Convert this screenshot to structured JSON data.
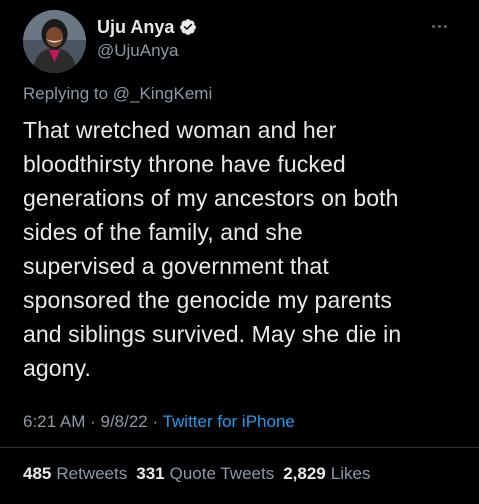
{
  "author": {
    "name": "Uju Anya",
    "handle": "@UjuAnya"
  },
  "reply_to": "Replying to @_KingKemi",
  "tweet_lines": [
    "That wretched woman and her",
    "bloodthirsty throne have fucked",
    "generations of my ancestors on both",
    "sides of the family, and she",
    "supervised a government that",
    "sponsored the genocide my parents",
    "and siblings survived. May she die in",
    "agony."
  ],
  "meta": {
    "time": "6:21 AM",
    "date": "9/8/22",
    "separator": "·",
    "source": "Twitter for iPhone"
  },
  "stats": {
    "retweets": {
      "count": "485",
      "label": "Retweets"
    },
    "quote_tweets": {
      "count": "331",
      "label": "Quote Tweets"
    },
    "likes": {
      "count": "2,829",
      "label": "Likes"
    }
  },
  "colors": {
    "background": "#000000",
    "text": "#e7e9ea",
    "secondary": "#8b98a5",
    "link": "#1d9bf0",
    "verified": "#1d9bf0"
  },
  "icons": {
    "verified": "verified-badge-icon",
    "more": "more-options-icon"
  }
}
